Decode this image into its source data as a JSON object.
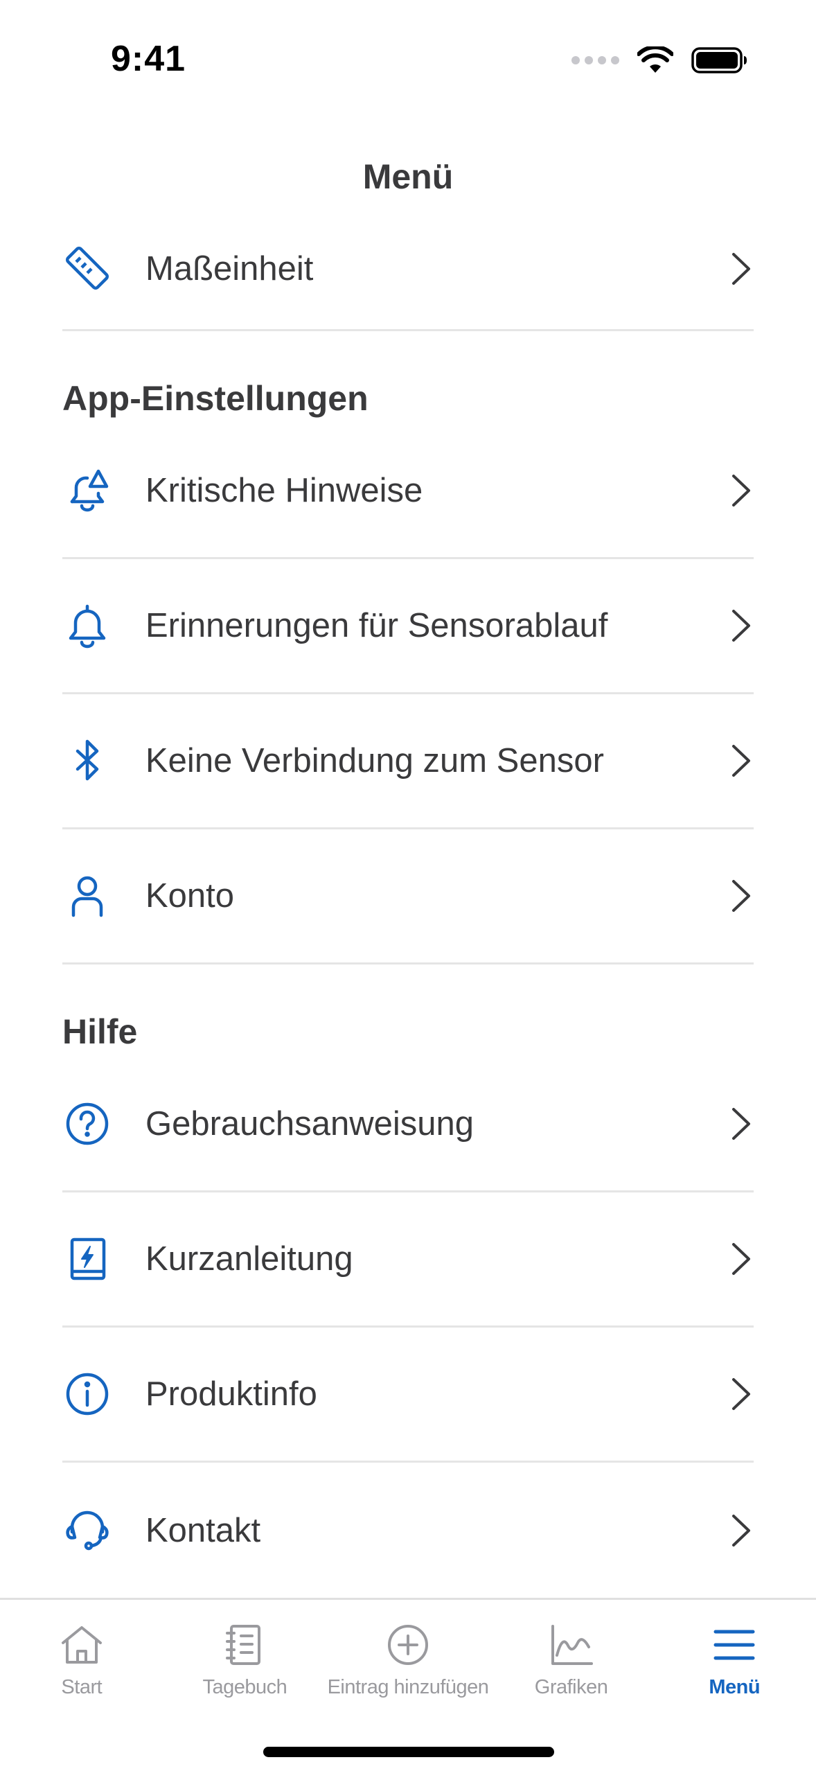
{
  "status_bar": {
    "time": "9:41"
  },
  "header": {
    "title": "Menü"
  },
  "colors": {
    "accent": "#1565c0",
    "text": "#3a3a3c",
    "inactive": "#9a9a9e",
    "divider": "#e5e5e5"
  },
  "top_items": [
    {
      "label": "Maßeinheit",
      "icon": "ruler-icon"
    }
  ],
  "sections": {
    "app_settings": {
      "title": "App-Einstellungen",
      "items": [
        {
          "label": "Kritische Hinweise",
          "icon": "bell-alert-icon"
        },
        {
          "label": "Erinnerungen für Sensorablauf",
          "icon": "bell-icon"
        },
        {
          "label": "Keine Verbindung zum Sensor",
          "icon": "bluetooth-icon"
        },
        {
          "label": "Konto",
          "icon": "user-icon"
        }
      ]
    },
    "help": {
      "title": "Hilfe",
      "items": [
        {
          "label": "Gebrauchsanweisung",
          "icon": "question-circle-icon"
        },
        {
          "label": "Kurzanleitung",
          "icon": "quick-guide-book-icon"
        },
        {
          "label": "Produktinfo",
          "icon": "info-circle-icon"
        },
        {
          "label": "Kontakt",
          "icon": "headset-icon"
        }
      ]
    }
  },
  "tab_bar": {
    "tabs": [
      {
        "label": "Start",
        "icon": "home-icon",
        "active": false
      },
      {
        "label": "Tagebuch",
        "icon": "logbook-icon",
        "active": false
      },
      {
        "label": "Eintrag hinzufügen",
        "icon": "add-circle-icon",
        "active": false
      },
      {
        "label": "Grafiken",
        "icon": "chart-icon",
        "active": false
      },
      {
        "label": "Menü",
        "icon": "menu-icon",
        "active": true
      }
    ]
  }
}
